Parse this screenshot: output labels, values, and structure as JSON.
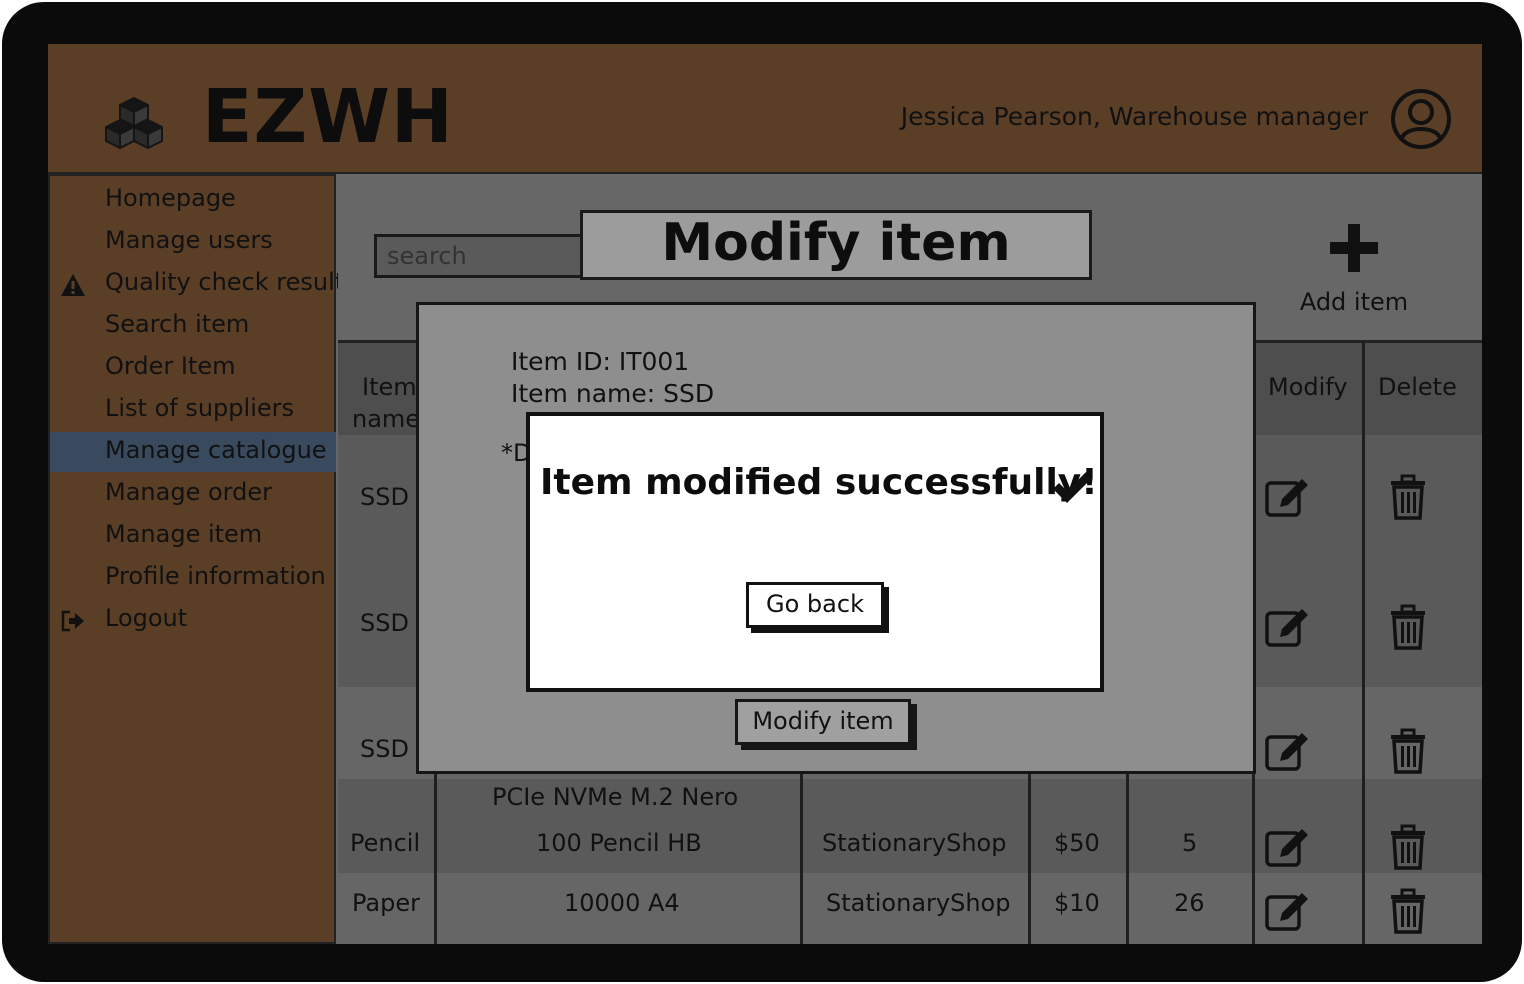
{
  "app": {
    "title": "EZWH",
    "user": "Jessica Pearson, Warehouse manager",
    "logo_icon": "cubes-icon",
    "avatar_icon": "user-circle-icon"
  },
  "sidebar": {
    "items": [
      {
        "label": "Homepage"
      },
      {
        "label": "Manage users"
      },
      {
        "label": "Quality check results",
        "icon": "warning-icon"
      },
      {
        "label": "Search item"
      },
      {
        "label": "Order Item"
      },
      {
        "label": "List of suppliers"
      },
      {
        "label": "Manage catalogue",
        "active": true
      },
      {
        "label": "Manage order"
      },
      {
        "label": "Manage item"
      },
      {
        "label": "Profile information"
      },
      {
        "label": "Logout",
        "icon": "logout-icon"
      }
    ]
  },
  "main": {
    "search_placeholder": "search",
    "page_title": "Modify item",
    "add_label": "Add item",
    "table": {
      "headers": {
        "item_name_1": "Item",
        "item_name_2": "name",
        "modify": "Modify",
        "delete": "Delete"
      },
      "rows": [
        {
          "name": "SSD"
        },
        {
          "name": "SSD"
        },
        {
          "name": "SSD",
          "description_tail": "PCIe NVMe M.2 Nero"
        },
        {
          "name": "Pencil",
          "description": "100 Pencil HB",
          "supplier": "StationaryShop",
          "price": "$50",
          "quantity": "5"
        },
        {
          "name": "Paper",
          "description": "10000 A4",
          "supplier": "StationaryShop",
          "price": "$10",
          "quantity": "26"
        }
      ]
    }
  },
  "modal": {
    "item_id": "Item ID: IT001",
    "item_name": "Item name: SSD",
    "partial_label": "*D",
    "modify_button": "Modify item"
  },
  "dialog": {
    "message": "Item modified successfully!",
    "button": "Go back",
    "icon": "checkmark-icon"
  },
  "colors": {
    "topbar": "#5a3e26",
    "active_nav": "#3a4a5e",
    "content": "#676767"
  }
}
